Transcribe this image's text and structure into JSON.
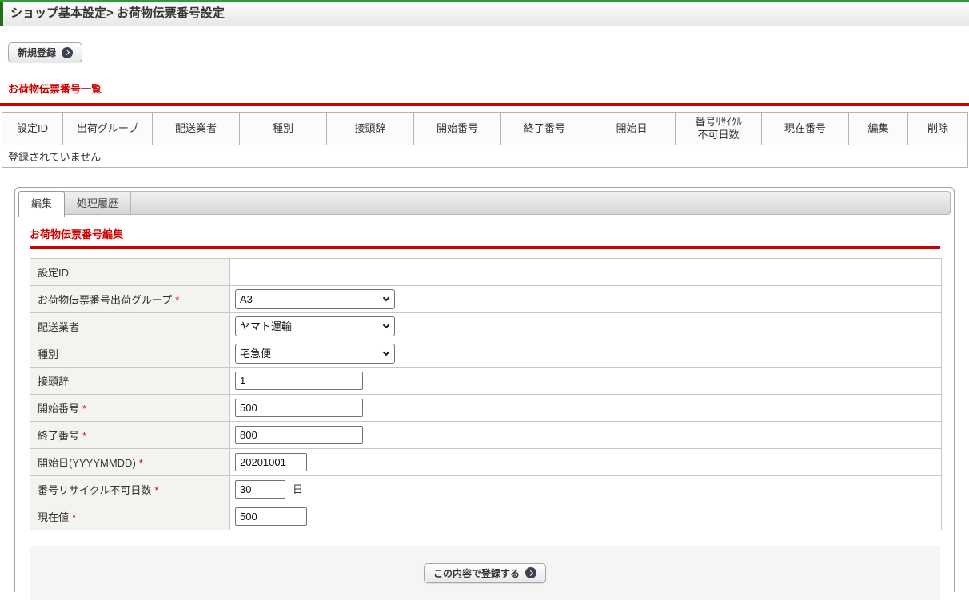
{
  "header": {
    "title": "ショップ基本設定> お荷物伝票番号設定"
  },
  "toolbar": {
    "new_button": "新規登録"
  },
  "list": {
    "heading": "お荷物伝票番号一覧",
    "columns": [
      "設定ID",
      "出荷グループ",
      "配送業者",
      "種別",
      "接頭辞",
      "開始番号",
      "終了番号",
      "開始日",
      "番号ﾘｻｲｸﾙ\n不可日数",
      "現在番号",
      "編集",
      "削除"
    ],
    "empty_message": "登録されていません"
  },
  "tabs": {
    "edit": "編集",
    "history": "処理履歴"
  },
  "form": {
    "heading": "お荷物伝票番号編集",
    "rows": [
      {
        "label": "設定ID",
        "value": ""
      },
      {
        "label": "お荷物伝票番号出荷グループ",
        "required": "*",
        "value": "A3"
      },
      {
        "label": "配送業者",
        "value": "ヤマト運輸"
      },
      {
        "label": "種別",
        "value": "宅急便"
      },
      {
        "label": "接頭辞",
        "value": "1"
      },
      {
        "label": "開始番号",
        "required": "*",
        "value": "500"
      },
      {
        "label": "終了番号",
        "required": "*",
        "value": "800"
      },
      {
        "label": "開始日(YYYYMMDD)",
        "required": "*",
        "value": "20201001"
      },
      {
        "label": "番号リサイクル不可日数",
        "required": "*",
        "value": "30",
        "suffix": "日"
      },
      {
        "label": "現在値",
        "required": "*",
        "value": "500"
      }
    ],
    "submit_button": "この内容で登録する"
  },
  "colors": {
    "accent_red": "#cc0000",
    "top_green": "#2f9c39",
    "title_border_green": "#1c701c",
    "icon_circle": "#3d4250"
  }
}
